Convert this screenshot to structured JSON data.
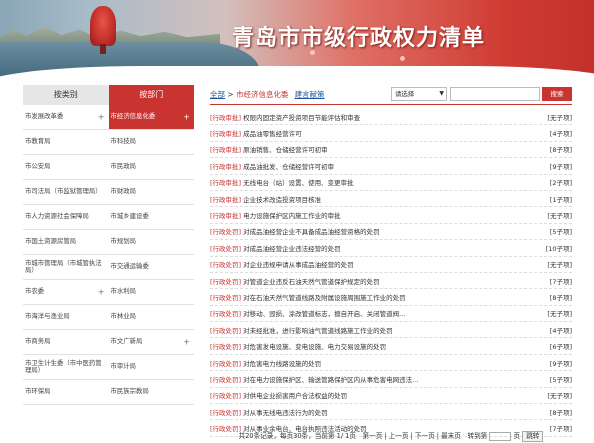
{
  "banner": {
    "title": "青岛市市级行政权力清单"
  },
  "left": {
    "tabs": [
      "按类别",
      "按部门"
    ],
    "rows": [
      [
        "市发展改革委",
        "市经济信息化委"
      ],
      [
        "市教育局",
        "市科技局"
      ],
      [
        "市公安局",
        "市民政局"
      ],
      [
        "市司法局（市监狱管理局）",
        "市财政局"
      ],
      [
        "市人力资源社会保障局",
        "市城乡建设委"
      ],
      [
        "市国土资源房管局",
        "市规划局"
      ],
      [
        "市城市管理局（市城管执法局）",
        "市交通运输委"
      ],
      [
        "市农委",
        "市水利局"
      ],
      [
        "市海洋与渔业局",
        "市林业局"
      ],
      [
        "市商务局",
        "市文广新局"
      ],
      [
        "市卫生计生委（市中医药管理局）",
        "市审计局"
      ],
      [
        "市环保局",
        "市民族宗教局"
      ]
    ],
    "plus_left": [
      0,
      7
    ],
    "plus_right": [
      0,
      9
    ],
    "selected": "市经济信息化委",
    "plus": "+"
  },
  "right": {
    "crumb_all": "全部",
    "crumb_sep": " > ",
    "crumb_dept": "市经济信息化委",
    "crumb_ob": "建言献策",
    "select_value": "请选择",
    "select_arrow": "▼",
    "search_label": "搜索",
    "items": [
      {
        "tag": "[行政审批]",
        "name": "权限内固定资产投资项目节能评估和审查",
        "cnt": "[无子项]"
      },
      {
        "tag": "[行政审批]",
        "name": "成品油零售经营许可",
        "cnt": "[4子项]"
      },
      {
        "tag": "[行政审批]",
        "name": "原油销售、仓储经营许可初审",
        "cnt": "[8子项]"
      },
      {
        "tag": "[行政审批]",
        "name": "成品油批发、仓储经营许可初审",
        "cnt": "[9子项]"
      },
      {
        "tag": "[行政审批]",
        "name": "无线电台（站）设置、使用、变更审批",
        "cnt": "[2子项]"
      },
      {
        "tag": "[行政审批]",
        "name": "企业技术改造投资项目核准",
        "cnt": "[1子项]"
      },
      {
        "tag": "[行政审批]",
        "name": "电力设施保护区内施工作业的审批",
        "cnt": "[无子项]"
      },
      {
        "tag": "[行政处罚]",
        "name": "对成品油经营企业不具备成品油经营资格的处罚",
        "cnt": "[5子项]"
      },
      {
        "tag": "[行政处罚]",
        "name": "对成品油经营企业违法经营的处罚",
        "cnt": "[10子项]"
      },
      {
        "tag": "[行政处罚]",
        "name": "对企业违规申请从事成品油经营的处罚",
        "cnt": "[无子项]"
      },
      {
        "tag": "[行政处罚]",
        "name": "对管道企业违反石油天然气管道保护规定的处罚",
        "cnt": "[7子项]"
      },
      {
        "tag": "[行政处罚]",
        "name": "对在石油天然气管道线路及附属设施周围施工作业的处罚",
        "cnt": "[8子项]"
      },
      {
        "tag": "[行政处罚]",
        "name": "对移动、毁损、涂改管道标志，擅自开启、关闭管道阀...",
        "cnt": "[无子项]"
      },
      {
        "tag": "[行政处罚]",
        "name": "对未经批准，进行影响油气管道线路施工作业的处罚",
        "cnt": "[4子项]"
      },
      {
        "tag": "[行政处罚]",
        "name": "对危害发电设施、变电设施、电力交易设施的处罚",
        "cnt": "[6子项]"
      },
      {
        "tag": "[行政处罚]",
        "name": "对危害电力线路设施的处罚",
        "cnt": "[9子项]"
      },
      {
        "tag": "[行政处罚]",
        "name": "对在电力设施保护区、输送管路保护区内从事危害电网违法...",
        "cnt": "[5子项]"
      },
      {
        "tag": "[行政处罚]",
        "name": "对供电企业损害用户合法权益的处罚",
        "cnt": "[无子项]"
      },
      {
        "tag": "[行政处罚]",
        "name": "对从事无线电违法行为的处罚",
        "cnt": "[8子项]"
      },
      {
        "tag": "[行政处罚]",
        "name": "对从事业余电台、电台执照违法活动的处罚",
        "cnt": "[7子项]"
      }
    ],
    "pager": {
      "text": "共20条记录，每页30条，当前第 1/ 1页　第一页 | 上一页 | 下一页 | 最末页　转到第",
      "suffix": "页",
      "go": "跳转"
    }
  }
}
